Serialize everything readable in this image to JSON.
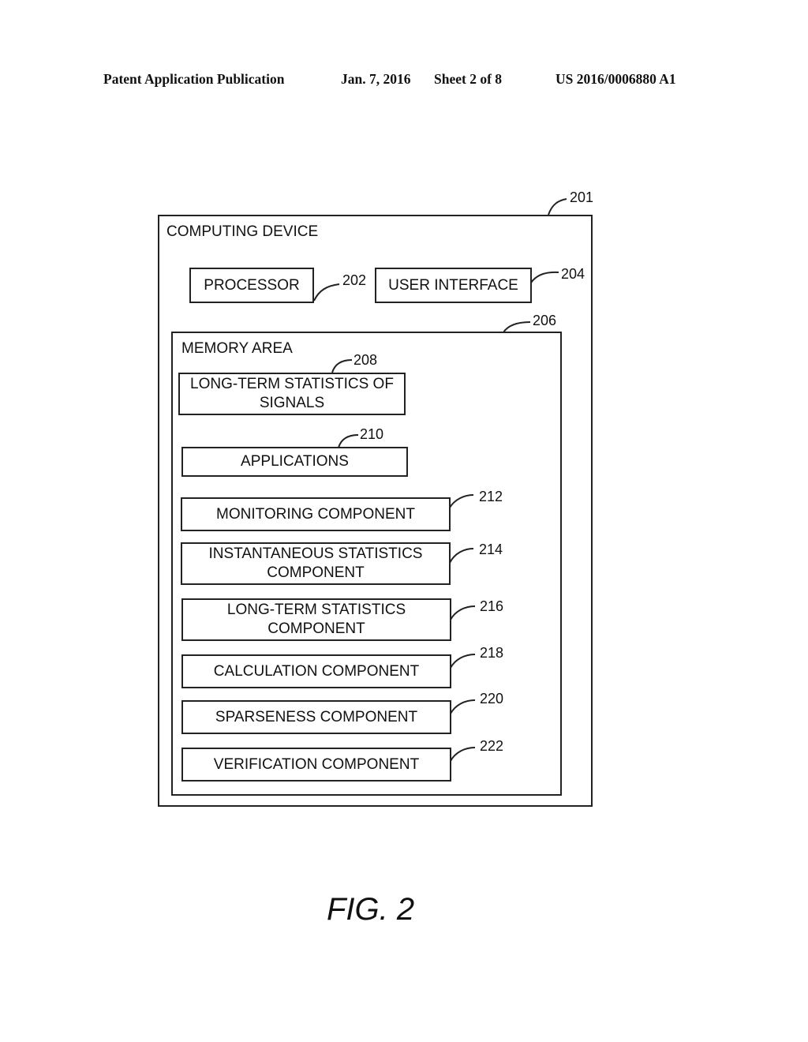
{
  "header": {
    "publication": "Patent Application Publication",
    "date": "Jan. 7, 2016",
    "sheet": "Sheet 2 of 8",
    "number": "US 2016/0006880 A1"
  },
  "diagram": {
    "computing_device": {
      "label": "COMPUTING DEVICE",
      "ref": "201"
    },
    "processor": {
      "label": "PROCESSOR",
      "ref": "202"
    },
    "user_interface": {
      "label": "USER INTERFACE",
      "ref": "204"
    },
    "memory_area": {
      "label": "MEMORY AREA",
      "ref": "206"
    },
    "long_term_signals": {
      "line1": "LONG-TERM STATISTICS OF",
      "line2": "SIGNALS",
      "ref": "208"
    },
    "applications": {
      "label": "APPLICATIONS",
      "ref": "210"
    },
    "components": [
      {
        "line1": "MONITORING COMPONENT",
        "line2": "",
        "ref": "212"
      },
      {
        "line1": "INSTANTANEOUS STATISTICS",
        "line2": "COMPONENT",
        "ref": "214"
      },
      {
        "line1": "LONG-TERM STATISTICS",
        "line2": "COMPONENT",
        "ref": "216"
      },
      {
        "line1": "CALCULATION COMPONENT",
        "line2": "",
        "ref": "218"
      },
      {
        "line1": "SPARSENESS COMPONENT",
        "line2": "",
        "ref": "220"
      },
      {
        "line1": "VERIFICATION COMPONENT",
        "line2": "",
        "ref": "222"
      }
    ]
  },
  "figure_label": "FIG. 2"
}
